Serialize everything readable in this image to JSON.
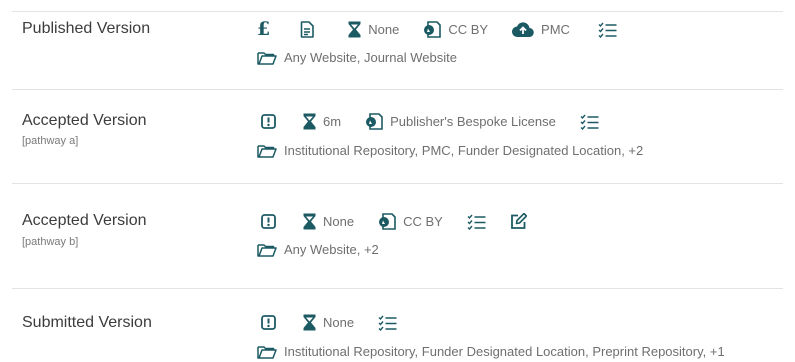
{
  "rows": [
    {
      "title": "Published Version",
      "pathway": "",
      "embargo": "None",
      "license": "CC BY",
      "deposit": "PMC",
      "locations": "Any Website, Journal Website"
    },
    {
      "title": "Accepted Version",
      "pathway": "[pathway a]",
      "embargo": "6m",
      "license": "Publisher's Bespoke License",
      "locations": "Institutional Repository, PMC, Funder Designated Location, +2"
    },
    {
      "title": "Accepted Version",
      "pathway": "[pathway b]",
      "embargo": "None",
      "license": "CC BY",
      "locations": "Any Website, +2"
    },
    {
      "title": "Submitted Version",
      "pathway": "",
      "embargo": "None",
      "locations": "Institutional Repository, Funder Designated Location, Preprint Repository, +1"
    }
  ],
  "icons": {
    "fee": "pound-icon",
    "copyright_owner": "document-icon",
    "embargo": "hourglass-icon",
    "license": "license-icon",
    "deposit": "cloud-upload-icon",
    "conditions": "checklist-icon",
    "prerequisites": "exclamation-icon",
    "edit": "edit-icon",
    "location": "folder-icon",
    "color": "#1c5a63"
  }
}
